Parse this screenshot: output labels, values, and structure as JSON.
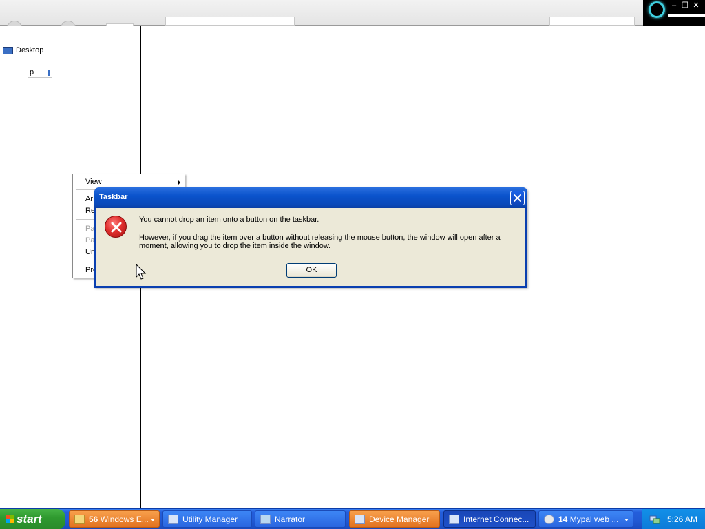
{
  "dialog": {
    "title": "Taskbar",
    "message_primary": "You cannot drop an item onto a button on the taskbar.",
    "message_secondary": "However, if you drag the item over a button without releasing the mouse button, the window will open after a moment, allowing you to drop the item inside the window.",
    "ok_label": "OK",
    "icon": "error-icon"
  },
  "left_pane": {
    "desktop_label": "Desktop",
    "rename_value": "p"
  },
  "context_menu": {
    "items": [
      {
        "label": "View",
        "disabled": false,
        "submenu": true
      },
      {
        "label": "Ar",
        "disabled": false
      },
      {
        "label": "Re",
        "disabled": false
      },
      {
        "label": "Pa",
        "disabled": true
      },
      {
        "label": "Pa",
        "disabled": true
      },
      {
        "label": "Un",
        "disabled": false
      },
      {
        "label": "Pro",
        "disabled": false
      }
    ]
  },
  "taskbar": {
    "start_label": "start",
    "buttons": [
      {
        "count": "56",
        "label": "Windows E...",
        "style": "orange",
        "dropdown": true
      },
      {
        "count": "",
        "label": "Utility Manager",
        "style": "normal",
        "dropdown": false
      },
      {
        "count": "",
        "label": "Narrator",
        "style": "normal",
        "dropdown": false
      },
      {
        "count": "",
        "label": "Device Manager",
        "style": "orange",
        "dropdown": false
      },
      {
        "count": "",
        "label": "Internet Connec...",
        "style": "active",
        "dropdown": false
      },
      {
        "count": "14",
        "label": "Mypal web ...",
        "style": "normal",
        "dropdown": true
      }
    ],
    "clock": "5:26 AM"
  },
  "colors": {
    "dialog_title_blue": "#0a53cc",
    "taskbar_blue": "#245edb",
    "start_green": "#2f9a2f",
    "dialog_face": "#ece9d8",
    "error_red": "#e0302e"
  }
}
